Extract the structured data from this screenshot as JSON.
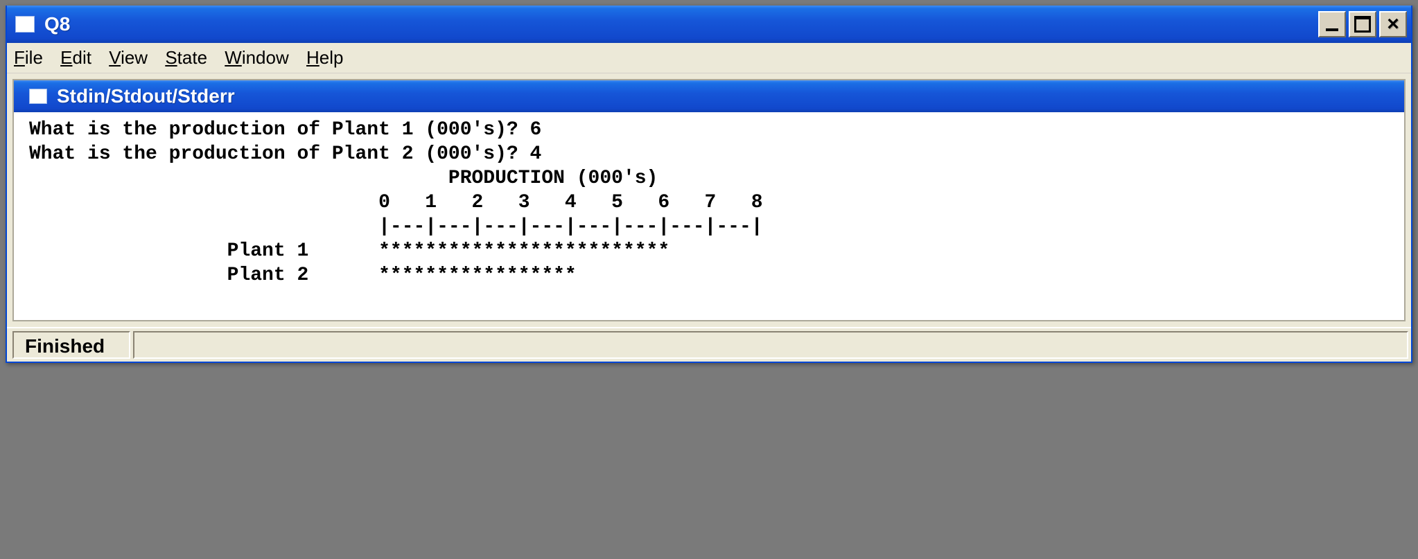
{
  "window": {
    "title": "Q8"
  },
  "menubar": {
    "items": [
      {
        "accel": "F",
        "rest": "ile"
      },
      {
        "accel": "E",
        "rest": "dit"
      },
      {
        "accel": "V",
        "rest": "iew"
      },
      {
        "accel": "S",
        "rest": "tate"
      },
      {
        "accel": "W",
        "rest": "indow"
      },
      {
        "accel": "H",
        "rest": "elp"
      }
    ]
  },
  "inner_window": {
    "title": "Stdin/Stdout/Stderr"
  },
  "console": {
    "lines": [
      "What is the production of Plant 1 (000's)? 6",
      "What is the production of Plant 2 (000's)? 4",
      "                                    PRODUCTION (000's)",
      "                              0   1   2   3   4   5   6   7   8",
      "                              |---|---|---|---|---|---|---|---|",
      "                 Plant 1      *************************",
      "                 Plant 2      *****************"
    ]
  },
  "status": {
    "text": "Finished"
  },
  "chart_data": {
    "type": "bar",
    "title": "PRODUCTION (000's)",
    "orientation": "horizontal",
    "categories": [
      "Plant 1",
      "Plant 2"
    ],
    "values": [
      6,
      4
    ],
    "xlabel": "",
    "ylabel": "",
    "xlim": [
      0,
      8
    ],
    "ticks": [
      0,
      1,
      2,
      3,
      4,
      5,
      6,
      7,
      8
    ]
  }
}
